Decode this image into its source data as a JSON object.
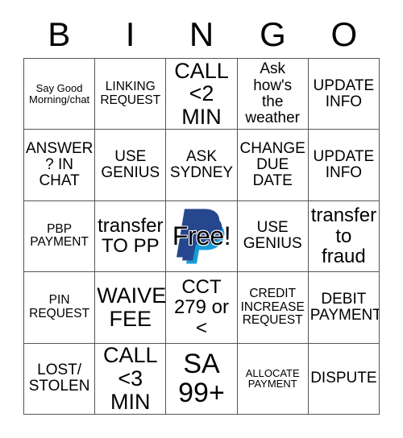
{
  "card": {
    "header": {
      "letters": [
        "B",
        "I",
        "N",
        "G",
        "O"
      ]
    },
    "colors": {
      "grid_line": "#555555",
      "background": "#ffffff",
      "text": "#000000",
      "paypal_dark_blue": "#26478D",
      "paypal_light_blue": "#179BD7"
    },
    "rows": [
      [
        {
          "text": "Say Good\nMorning/chat",
          "size": "xs"
        },
        {
          "text": "LINKING\nREQUEST",
          "size": "sm"
        },
        {
          "text": "CALL\n<2 MIN",
          "size": "xl"
        },
        {
          "text": "Ask how's\nthe\nweather",
          "size": "md"
        },
        {
          "text": "UPDATE\nINFO",
          "size": "md"
        }
      ],
      [
        {
          "text": "ANSWER\n? IN\nCHAT",
          "size": "md"
        },
        {
          "text": "USE\nGENIUS",
          "size": "md"
        },
        {
          "text": "ASK\nSYDNEY",
          "size": "md"
        },
        {
          "text": "CHANGE\nDUE\nDATE",
          "size": "md"
        },
        {
          "text": "UPDATE\nINFO",
          "size": "md"
        }
      ],
      [
        {
          "text": "PBP\nPAYMENT",
          "size": "sm"
        },
        {
          "text": "transfer\nTO PP",
          "size": "lg"
        },
        {
          "text": "Free!",
          "size": "free",
          "icon": "paypal-logo"
        },
        {
          "text": "USE\nGENIUS",
          "size": "md"
        },
        {
          "text": "transfer\nto\nfraud",
          "size": "lg"
        }
      ],
      [
        {
          "text": "PIN\nREQUEST",
          "size": "sm"
        },
        {
          "text": "WAIVE\nFEE",
          "size": "xl"
        },
        {
          "text": "CCT\n279 or\n<",
          "size": "lg"
        },
        {
          "text": "CREDIT\nINCREASE\nREQUEST",
          "size": "sm"
        },
        {
          "text": "DEBIT\nPAYMENT",
          "size": "md"
        }
      ],
      [
        {
          "text": "LOST/\nSTOLEN",
          "size": "md"
        },
        {
          "text": "CALL\n<3 MIN",
          "size": "xl"
        },
        {
          "text": "SA\n99+",
          "size": "xxl"
        },
        {
          "text": "ALLOCATE\nPAYMENT",
          "size": "xs"
        },
        {
          "text": "DISPUTE",
          "size": "md"
        }
      ]
    ]
  }
}
